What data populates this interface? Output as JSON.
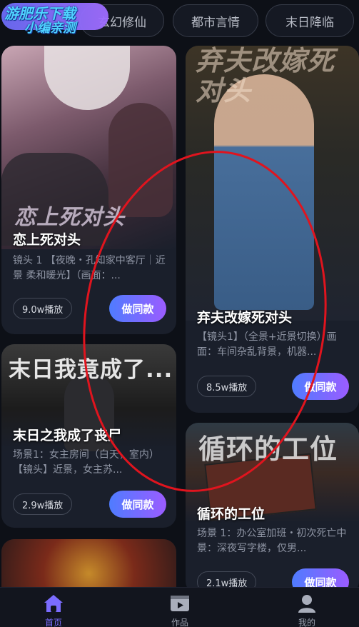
{
  "watermark": {
    "line1": "游肥乐下载",
    "line2": "小编亲测"
  },
  "categories": [
    {
      "label": "玄幻修仙"
    },
    {
      "label": "都市言情"
    },
    {
      "label": "末日降临"
    }
  ],
  "cards": [
    {
      "poster_text": "恋上死对头",
      "title": "恋上死对头",
      "desc": "镜头 1 【夜晚・孔知家中客厅｜近景 柔和暖光】（画面：...",
      "plays": "9.0w播放",
      "button": "做同款"
    },
    {
      "poster_text": "弃夫改嫁死对头",
      "title": "弃夫改嫁死对头",
      "desc": "【镜头1】（全景+近景切换）画面：车间杂乱背景，机器...",
      "plays": "8.5w播放",
      "button": "做同款"
    },
    {
      "poster_text": "末日我竟成了...",
      "title": "末日之我成了丧尸",
      "desc": "场景1：女主房间（白天，室内）【镜头】近景，女主苏...",
      "plays": "2.9w播放",
      "button": "做同款"
    },
    {
      "poster_text": "循环的工位",
      "title": "循环的工位",
      "desc": "场景 1：办公室加班・初次死亡中景：深夜写字楼，仅男...",
      "plays": "2.1w播放",
      "button": "做同款"
    }
  ],
  "nav": [
    {
      "label": "首页",
      "icon": "home-icon",
      "active": true
    },
    {
      "label": "作品",
      "icon": "video-icon",
      "active": false
    },
    {
      "label": "我的",
      "icon": "user-icon",
      "active": false
    }
  ],
  "colors": {
    "accent": "#7b6cff",
    "button_gradient_start": "#4f7cff",
    "button_gradient_end": "#9b5cff",
    "annotation": "#e0141e",
    "background": "#0d1017"
  }
}
